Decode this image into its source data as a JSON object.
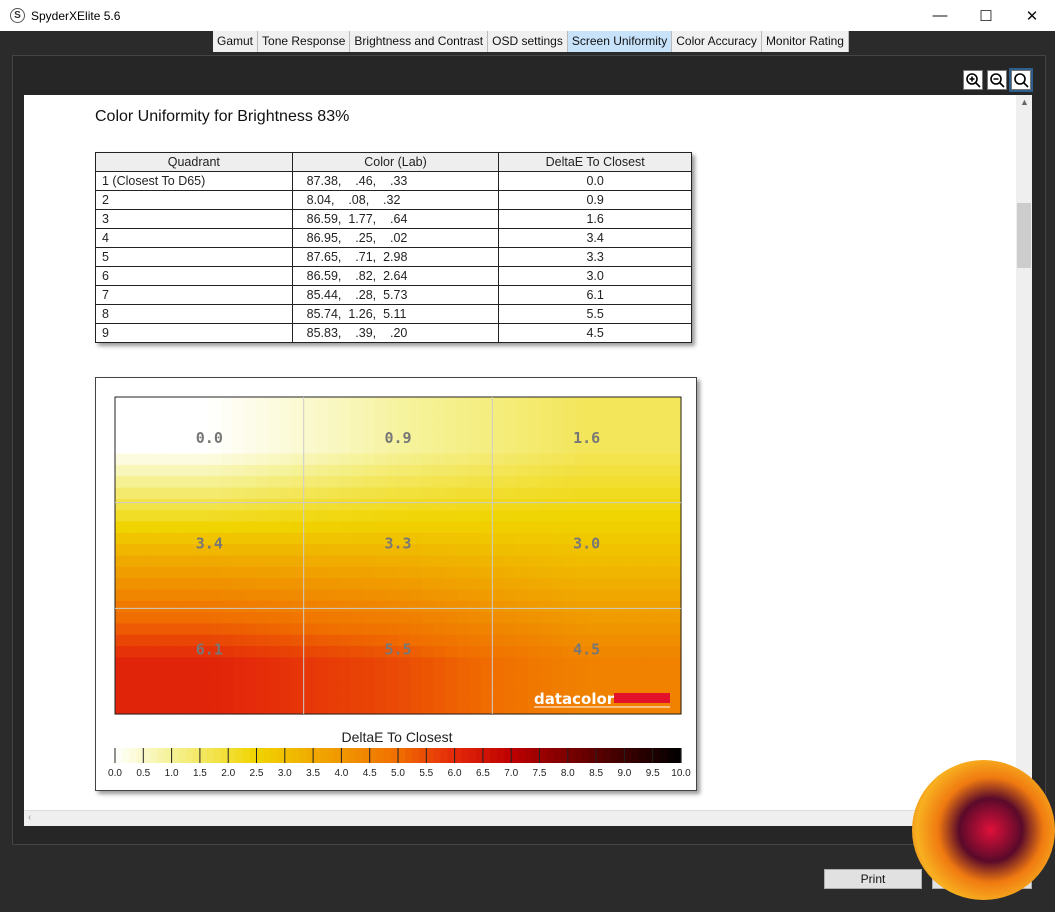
{
  "window": {
    "title": "SpyderXElite 5.6",
    "app_icon": "S"
  },
  "tabs": [
    {
      "label": "Gamut"
    },
    {
      "label": "Tone Response"
    },
    {
      "label": "Brightness and Contrast"
    },
    {
      "label": "OSD settings"
    },
    {
      "label": "Screen Uniformity",
      "active": true
    },
    {
      "label": "Color Accuracy"
    },
    {
      "label": "Monitor Rating"
    }
  ],
  "report": {
    "heading": "Color Uniformity for Brightness 83%",
    "columns": [
      "Quadrant",
      "Color (Lab)",
      "DeltaE To Closest"
    ],
    "rows": [
      [
        "1 (Closest To D65)",
        "87.38,    .46,    .33",
        "0.0"
      ],
      [
        "2",
        "8.04,    .08,    .32",
        "0.9"
      ],
      [
        "3",
        "86.59,  1.77,    .64",
        "1.6"
      ],
      [
        "4",
        "86.95,    .25,    .02",
        "3.4"
      ],
      [
        "5",
        "87.65,    .71,  2.98",
        "3.3"
      ],
      [
        "6",
        "86.59,    .82,  2.64",
        "3.0"
      ],
      [
        "7",
        "85.44,    .28,  5.73",
        "6.1"
      ],
      [
        "8",
        "85.74,  1.26,  5.11",
        "5.5"
      ],
      [
        "9",
        "85.83,    .39,    .20",
        "4.5"
      ]
    ]
  },
  "heatmap": {
    "values": [
      [
        0.0,
        0.9,
        1.6
      ],
      [
        3.4,
        3.3,
        3.0
      ],
      [
        6.1,
        5.5,
        4.5
      ]
    ],
    "labels": [
      [
        "0.0",
        "0.9",
        "1.6"
      ],
      [
        "3.4",
        "3.3",
        "3.0"
      ],
      [
        "6.1",
        "5.5",
        "4.5"
      ]
    ],
    "colorbar_title": "DeltaE To Closest",
    "colorbar_ticks": [
      "0.0",
      "0.5",
      "1.0",
      "1.5",
      "2.0",
      "2.5",
      "3.0",
      "3.5",
      "4.0",
      "4.5",
      "5.0",
      "5.5",
      "6.0",
      "6.5",
      "7.0",
      "7.5",
      "8.0",
      "8.5",
      "9.0",
      "9.5",
      "10.0"
    ],
    "range": [
      0,
      10
    ],
    "brand": "datacolor",
    "brand_color": "#e3122b"
  },
  "buttons": {
    "print": "Print"
  },
  "icons": [
    "zoom-in-icon",
    "zoom-out-icon",
    "zoom-fit-icon"
  ]
}
